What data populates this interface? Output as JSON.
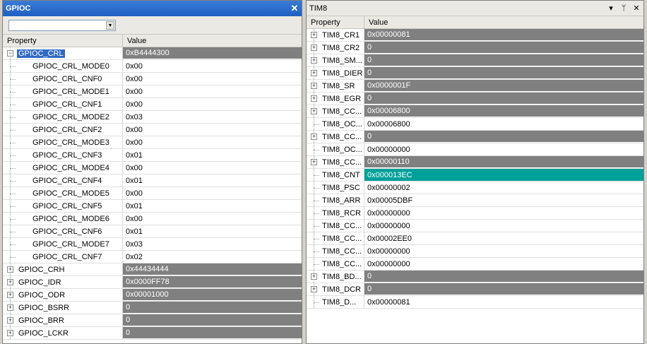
{
  "left_panel": {
    "title": "GPIOC",
    "close_label": "✕",
    "combo_value": "",
    "header": {
      "property": "Property",
      "value": "Value"
    },
    "rows": [
      {
        "name": "GPIOC_CRL",
        "value": "0xB4444300",
        "level": 0,
        "expander": "−",
        "style": "dark",
        "selected": true
      },
      {
        "name": "GPIOC_CRL_MODE0",
        "value": "0x00",
        "level": 1
      },
      {
        "name": "GPIOC_CRL_CNF0",
        "value": "0x00",
        "level": 1
      },
      {
        "name": "GPIOC_CRL_MODE1",
        "value": "0x00",
        "level": 1
      },
      {
        "name": "GPIOC_CRL_CNF1",
        "value": "0x00",
        "level": 1
      },
      {
        "name": "GPIOC_CRL_MODE2",
        "value": "0x03",
        "level": 1
      },
      {
        "name": "GPIOC_CRL_CNF2",
        "value": "0x00",
        "level": 1
      },
      {
        "name": "GPIOC_CRL_MODE3",
        "value": "0x00",
        "level": 1
      },
      {
        "name": "GPIOC_CRL_CNF3",
        "value": "0x01",
        "level": 1
      },
      {
        "name": "GPIOC_CRL_MODE4",
        "value": "0x00",
        "level": 1
      },
      {
        "name": "GPIOC_CRL_CNF4",
        "value": "0x01",
        "level": 1
      },
      {
        "name": "GPIOC_CRL_MODE5",
        "value": "0x00",
        "level": 1
      },
      {
        "name": "GPIOC_CRL_CNF5",
        "value": "0x01",
        "level": 1
      },
      {
        "name": "GPIOC_CRL_MODE6",
        "value": "0x00",
        "level": 1
      },
      {
        "name": "GPIOC_CRL_CNF6",
        "value": "0x01",
        "level": 1
      },
      {
        "name": "GPIOC_CRL_MODE7",
        "value": "0x03",
        "level": 1
      },
      {
        "name": "GPIOC_CRL_CNF7",
        "value": "0x02",
        "level": 1
      },
      {
        "name": "GPIOC_CRH",
        "value": "0x44434444",
        "level": 0,
        "expander": "+",
        "style": "dark"
      },
      {
        "name": "GPIOC_IDR",
        "value": "0x0000FF78",
        "level": 0,
        "expander": "+",
        "style": "dark"
      },
      {
        "name": "GPIOC_ODR",
        "value": "0x00001000",
        "level": 0,
        "expander": "+",
        "style": "dark"
      },
      {
        "name": "GPIOC_BSRR",
        "value": "0",
        "level": 0,
        "expander": "+",
        "style": "dark"
      },
      {
        "name": "GPIOC_BRR",
        "value": "0",
        "level": 0,
        "expander": "+",
        "style": "dark"
      },
      {
        "name": "GPIOC_LCKR",
        "value": "0",
        "level": 0,
        "expander": "+",
        "style": "dark"
      }
    ]
  },
  "right_panel": {
    "title": "TIM8",
    "buttons": [
      "▾",
      "ᛘ",
      "✕"
    ],
    "header": {
      "property": "Property",
      "value": "Value"
    },
    "rows": [
      {
        "name": "TIM8_CR1",
        "value": "0x00000081",
        "level": 0,
        "expander": "+",
        "style": "dark"
      },
      {
        "name": "TIM8_CR2",
        "value": "0",
        "level": 0,
        "expander": "+",
        "style": "dark"
      },
      {
        "name": "TIM8_SM...",
        "value": "0",
        "level": 0,
        "expander": "+",
        "style": "dark"
      },
      {
        "name": "TIM8_DIER",
        "value": "0",
        "level": 0,
        "expander": "+",
        "style": "dark"
      },
      {
        "name": "TIM8_SR",
        "value": "0x0000001F",
        "level": 0,
        "expander": "+",
        "style": "dark"
      },
      {
        "name": "TIM8_EGR",
        "value": "0",
        "level": 0,
        "expander": "+",
        "style": "dark"
      },
      {
        "name": "TIM8_CC...",
        "value": "0x00006800",
        "level": 0,
        "expander": "+",
        "style": "dark"
      },
      {
        "name": "TIM8_OC...",
        "value": "0x00006800",
        "level": 0
      },
      {
        "name": "TIM8_CC...",
        "value": "0",
        "level": 0,
        "expander": "+",
        "style": "dark"
      },
      {
        "name": "TIM8_OC...",
        "value": "0x00000000",
        "level": 0
      },
      {
        "name": "TIM8_CC...",
        "value": "0x00000110",
        "level": 0,
        "expander": "+",
        "style": "dark"
      },
      {
        "name": "TIM8_CNT",
        "value": "0x000013EC",
        "level": 0,
        "style": "teal"
      },
      {
        "name": "TIM8_PSC",
        "value": "0x00000002",
        "level": 0
      },
      {
        "name": "TIM8_ARR",
        "value": "0x00005DBF",
        "level": 0
      },
      {
        "name": "TIM8_RCR",
        "value": "0x00000000",
        "level": 0
      },
      {
        "name": "TIM8_CC...",
        "value": "0x00000000",
        "level": 0
      },
      {
        "name": "TIM8_CC...",
        "value": "0x00002EE0",
        "level": 0
      },
      {
        "name": "TIM8_CC...",
        "value": "0x00000000",
        "level": 0
      },
      {
        "name": "TIM8_CC...",
        "value": "0x00000000",
        "level": 0
      },
      {
        "name": "TIM8_BD...",
        "value": "0",
        "level": 0,
        "expander": "+",
        "style": "dark"
      },
      {
        "name": "TIM8_DCR",
        "value": "0",
        "level": 0,
        "expander": "+",
        "style": "dark"
      },
      {
        "name": "TIM8_D...",
        "value": "0x00000081",
        "level": 0
      }
    ]
  }
}
